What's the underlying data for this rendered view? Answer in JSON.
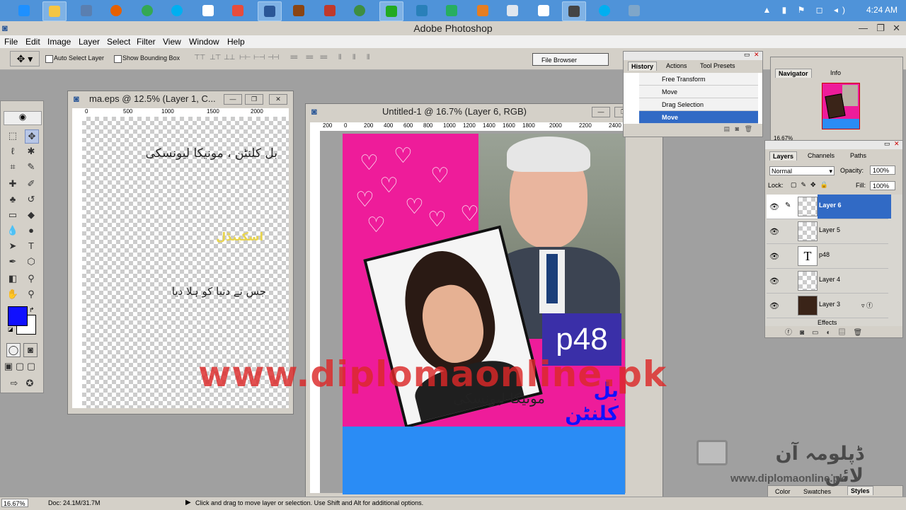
{
  "taskbar": {
    "apps": [
      "ie-icon",
      "explorer-icon",
      "calculator-icon",
      "firefox-icon",
      "chrome-icon",
      "skype-icon",
      "word-icon",
      "screen-recorder-icon",
      "photoshop-icon",
      "media-icon",
      "paint-icon",
      "earth-icon",
      "network-icon",
      "security-icon",
      "app-icon",
      "app-icon",
      "keyboard-icon",
      "notepad-icon",
      "app-icon",
      "skype-icon",
      "media-icon"
    ],
    "clock": "4:24 AM"
  },
  "app": {
    "title": "Adobe Photoshop",
    "menu": [
      "File",
      "Edit",
      "Image",
      "Layer",
      "Select",
      "Filter",
      "View",
      "Window",
      "Help"
    ]
  },
  "options": {
    "auto_select_layer": "Auto Select Layer",
    "show_bounding_box": "Show Bounding Box",
    "file_browser": "File Browser"
  },
  "doc1": {
    "title": "ma.eps @ 12.5% (Layer 1, C...",
    "ruler_labels": [
      "0",
      "500",
      "1000",
      "1500",
      "2000"
    ],
    "text_line1": "بل کلنٹن ، مونیکا لیونسکی",
    "text_line2": "اسکینڈل",
    "text_line3": "جس نے دنیا کو ہلا دیا"
  },
  "doc2": {
    "title": "Untitled-1 @ 16.7% (Layer 6, RGB)",
    "ruler_labels": [
      "200",
      "0",
      "200",
      "400",
      "600",
      "800",
      "1000",
      "1200",
      "1400",
      "1600",
      "1800",
      "2000",
      "2200",
      "2400"
    ],
    "badge": "p48",
    "urdu_caption_blue": "بل کلنٹن",
    "urdu_caption_black": "مونیکا لیونسکی",
    "watermark": "www.diplomaonline.pk"
  },
  "history": {
    "tabs": [
      "History",
      "Actions",
      "Tool Presets"
    ],
    "items": [
      "Free Transform",
      "Move",
      "Drag Selection",
      "Move"
    ]
  },
  "navigator": {
    "tabs": [
      "Navigator",
      "Info"
    ],
    "zoom": "16.67%"
  },
  "layers": {
    "tabs": [
      "Layers",
      "Channels",
      "Paths"
    ],
    "blend_mode": "Normal",
    "opacity_label": "Opacity:",
    "opacity": "100%",
    "lock_label": "Lock:",
    "fill_label": "Fill:",
    "fill": "100%",
    "items": [
      "Layer 6",
      "Layer 5",
      "p48",
      "Layer 4",
      "Layer 3"
    ],
    "effects": "Effects"
  },
  "bottom_palette": {
    "tabs": [
      "Color",
      "Swatches",
      "Styles"
    ]
  },
  "branding": {
    "urdu_name": "ڈپلومہ آن لائن",
    "url": "www.diplomaonline.pk"
  },
  "status": {
    "zoom": "16.67%",
    "doc": "Doc: 24.1M/31.7M",
    "hint": "Click and drag to move layer or selection.  Use Shift and Alt for additional options."
  },
  "colors": {
    "foreground": "#1010ff",
    "background": "#ffffff",
    "magenta": "#ee1c9a",
    "blue_band": "#2a8cf5"
  }
}
